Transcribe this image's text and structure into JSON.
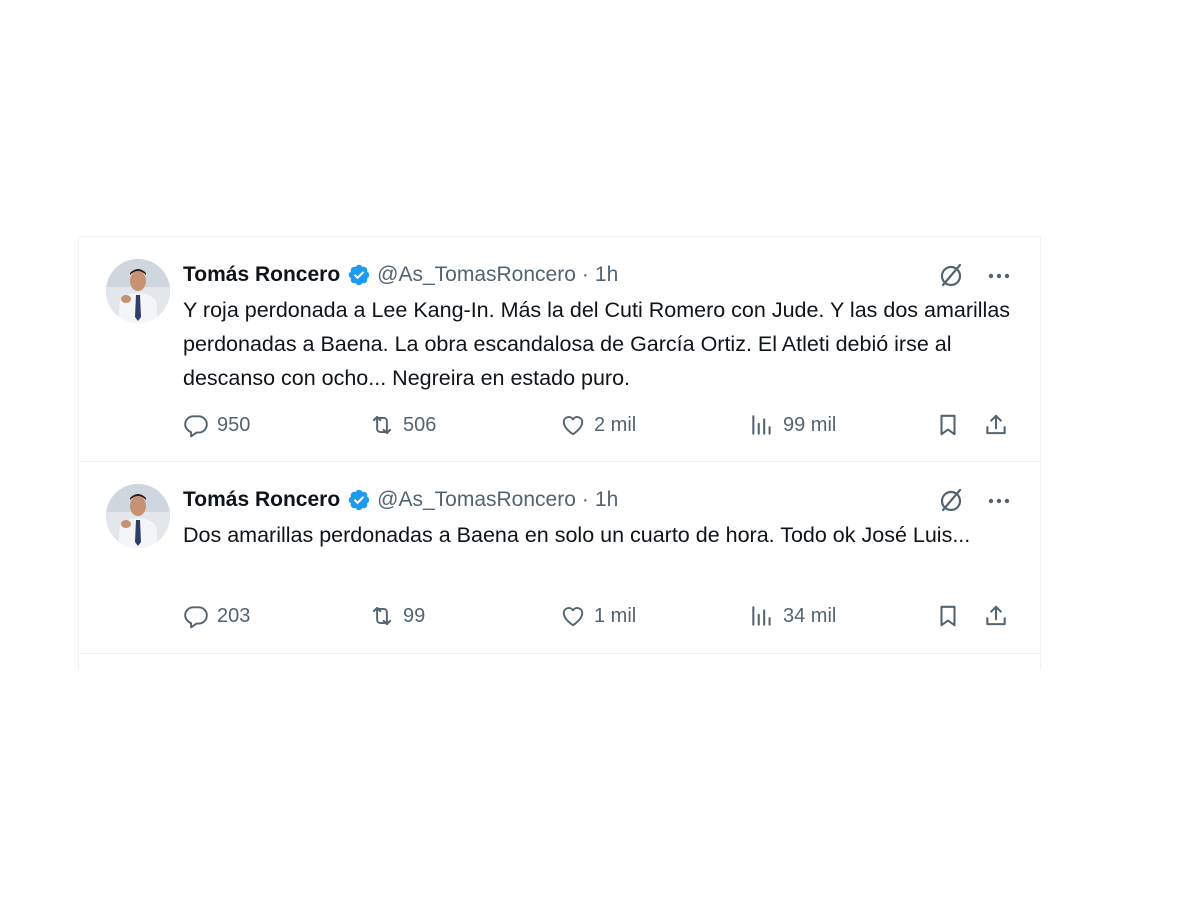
{
  "tweets": [
    {
      "name": "Tomás Roncero",
      "handle": "@As_TomasRoncero",
      "separator": "·",
      "time": "1h",
      "text": "Y roja perdonada a Lee Kang-In. Más la del Cuti Romero con Jude. Y las dos amarillas perdonadas a Baena. La obra escandalosa de García Ortiz. El Atleti debió irse al descanso con ocho... Negreira en estado puro.",
      "replies": "950",
      "retweets": "506",
      "likes": "2 mil",
      "views": "99 mil"
    },
    {
      "name": "Tomás Roncero",
      "handle": "@As_TomasRoncero",
      "separator": "·",
      "time": "1h",
      "text": "Dos amarillas perdonadas a Baena en solo un cuarto de hora. Todo ok José Luis...",
      "replies": "203",
      "retweets": "99",
      "likes": "1 mil",
      "views": "34 mil"
    }
  ],
  "icons": {
    "verified": "verified-badge-icon",
    "grok": "grok-icon",
    "more": "more-icon",
    "reply": "reply-icon",
    "retweet": "retweet-icon",
    "like": "heart-icon",
    "views": "views-chart-icon",
    "bookmark": "bookmark-icon",
    "share": "share-icon"
  },
  "colors": {
    "text_primary": "#0f1419",
    "text_secondary": "#536471",
    "verified_blue": "#1d9bf0",
    "border": "#eff3f4"
  }
}
